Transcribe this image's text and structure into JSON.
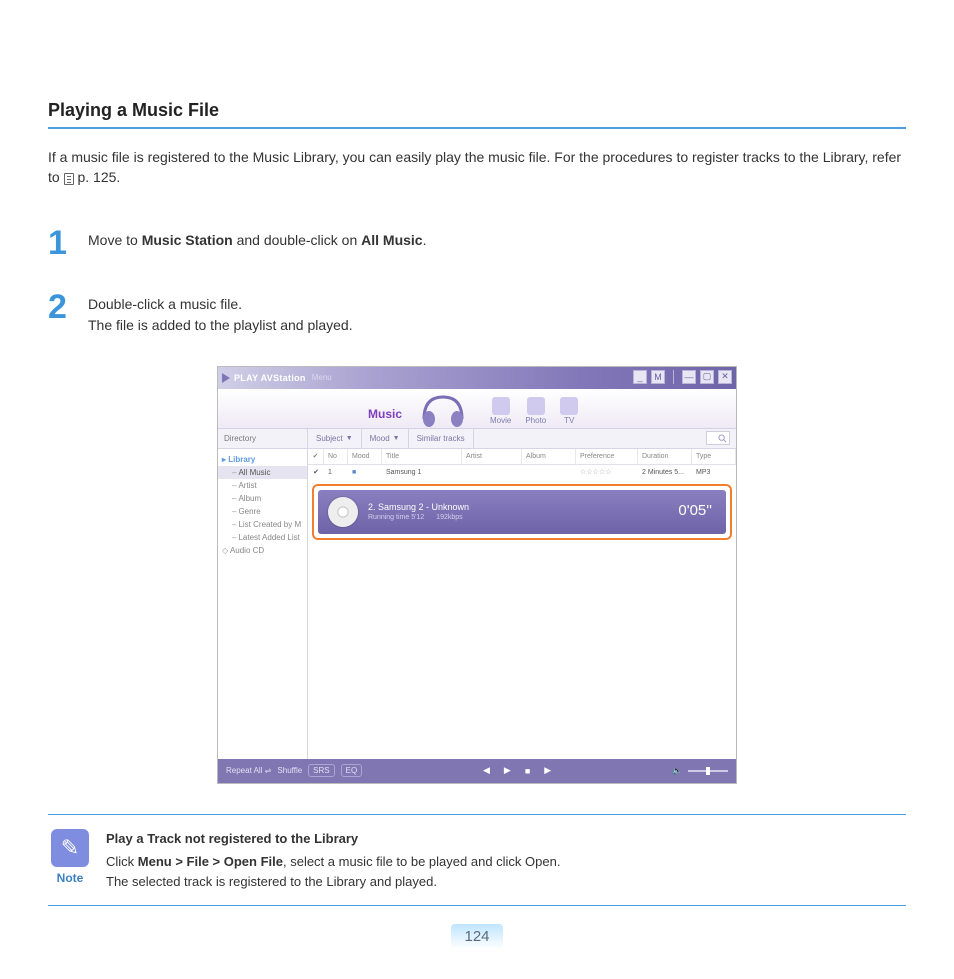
{
  "heading": "Playing a Music File",
  "intro_before": "If a music file is registered to the Music Library, you can easily play the music file. For the procedures to register tracks to the Library, refer to ",
  "intro_page": " p. 125.",
  "step1": {
    "num": "1",
    "a": "Move to ",
    "b": "Music Station",
    "c": " and double-click on ",
    "d": "All Music",
    "e": "."
  },
  "step2": {
    "num": "2",
    "l1": "Double-click a music file.",
    "l2": "The file is added to the playlist and played."
  },
  "app": {
    "title": "PLAY AVStation",
    "menu": "Menu",
    "win": {
      "min": "_",
      "m": "M",
      "br": "—",
      "sq": "▢",
      "x": "✕"
    },
    "music_label": "Music",
    "tabs": {
      "movie": "Movie",
      "photo": "Photo",
      "tv": "TV"
    },
    "toolbar": {
      "directory": "Directory",
      "subject": "Subject",
      "mood": "Mood",
      "similar": "Similar tracks"
    },
    "side": {
      "library": "Library",
      "all": "All Music",
      "artist": "Artist",
      "album": "Album",
      "genre": "Genre",
      "list_created": "List Created by M",
      "latest": "Latest Added List",
      "audio_cd": "Audio CD"
    },
    "cols": {
      "no": "No",
      "mood": "Mood",
      "title": "Title",
      "artist": "Artist",
      "album": "Album",
      "pref": "Preference",
      "dur": "Duration",
      "type": "Type"
    },
    "row1": {
      "check": "✔",
      "no": "1",
      "mood": "■",
      "title": "Samsung 1",
      "pref": "☆☆☆☆☆",
      "dur": "2 Minutes 5...",
      "type": "MP3"
    },
    "nowplaying": {
      "line1": "2.  Samsung 2 - Unknown",
      "running": "Running time 5'12",
      "bitrate": "192kbps",
      "time": "0'05''"
    },
    "player": {
      "repeat": "Repeat All",
      "shuffle": "Shuffle",
      "srs": "SRS",
      "eq": "EQ",
      "prev": "◀",
      "play": "▶",
      "stop": "■",
      "next": "▶"
    }
  },
  "note": {
    "label": "Note",
    "title": "Play a Track not registered to the Library",
    "a": "Click ",
    "b": "Menu > File > Open File",
    "c": ", select a music file to be played and click Open.",
    "d": "The selected track is registered to the Library and played."
  },
  "page_number": "124"
}
